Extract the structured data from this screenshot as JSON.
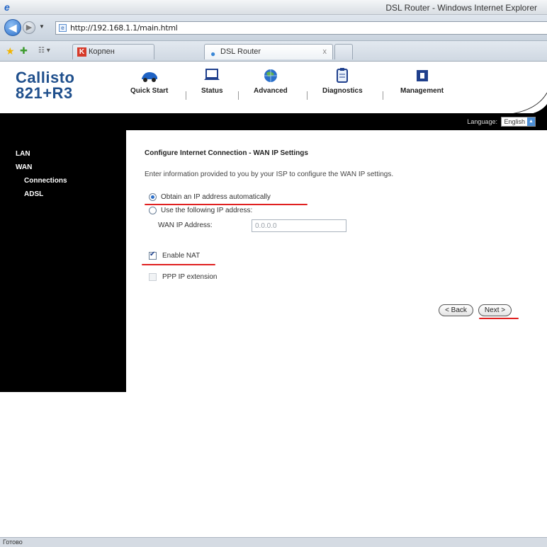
{
  "browser": {
    "window_title": "DSL Router - Windows Internet Explorer",
    "url": "http://192.168.1.1/main.html",
    "tabs": [
      {
        "label": "Корпен"
      },
      {
        "label": "DSL Router"
      }
    ],
    "status_text": "Готово"
  },
  "router": {
    "brand_line1": "Callisto",
    "brand_line2": "821+R3",
    "nav": [
      {
        "label": "Quick Start"
      },
      {
        "label": "Status"
      },
      {
        "label": "Advanced"
      },
      {
        "label": "Diagnostics"
      },
      {
        "label": "Management"
      }
    ],
    "language_label": "Language:",
    "language_value": "English"
  },
  "sidebar": {
    "items": [
      {
        "label": "LAN"
      },
      {
        "label": "WAN"
      },
      {
        "label": "Connections"
      },
      {
        "label": "ADSL"
      }
    ]
  },
  "main": {
    "title": "Configure Internet Connection - WAN IP Settings",
    "intro": "Enter information provided to you by your ISP to configure the WAN IP settings.",
    "option_auto": "Obtain an IP address automatically",
    "option_manual": "Use the following IP address:",
    "wan_ip_label": "WAN IP Address:",
    "wan_ip_value": "0.0.0.0",
    "enable_nat": "Enable NAT",
    "ppp_ip_ext": "PPP IP extension",
    "back_button": "< Back",
    "next_button": "Next >"
  },
  "colors": {
    "brand": "#1f4f8c",
    "annotation_red": "#e02020"
  }
}
